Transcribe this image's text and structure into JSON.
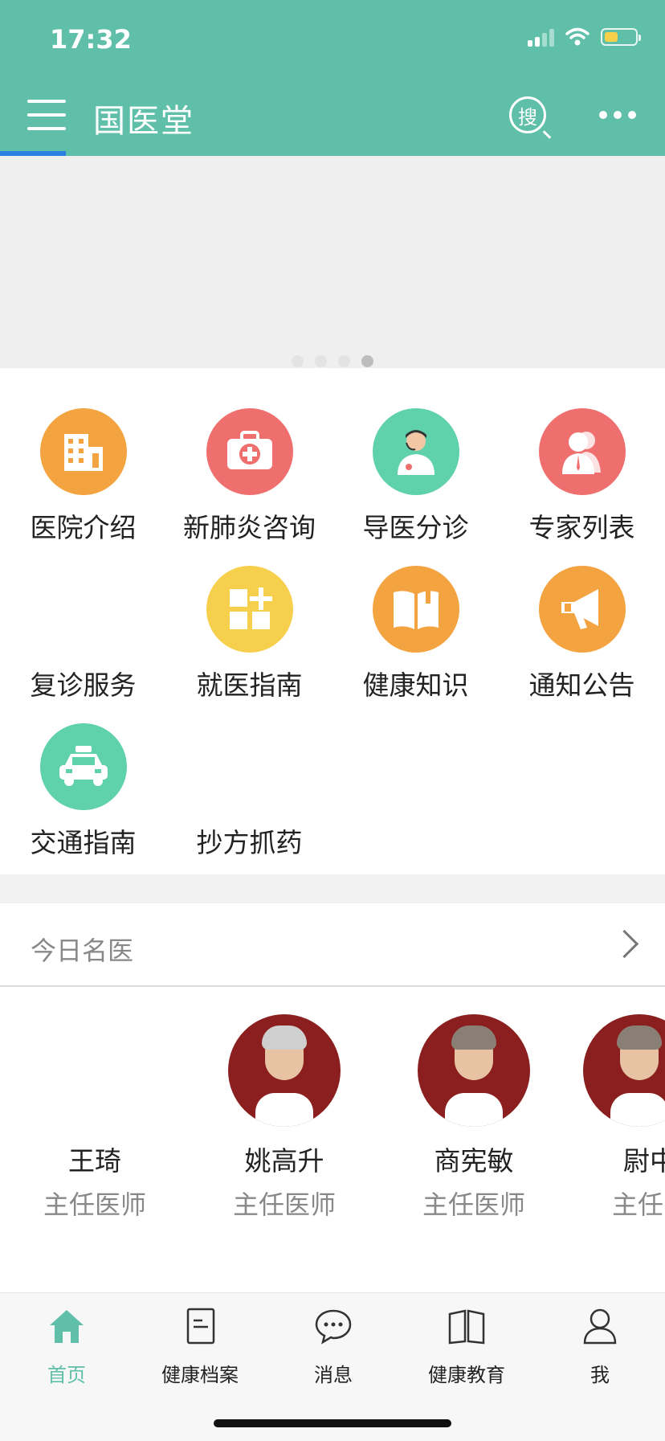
{
  "status": {
    "time": "17:32"
  },
  "header": {
    "title": "国医堂"
  },
  "colors": {
    "header": "#5fbfa9",
    "accent_tab": "#5fbfa9",
    "underline": "#2b7fe0"
  },
  "banner": {
    "dots_total": 4,
    "active_dot": 4
  },
  "grid": {
    "items": [
      {
        "label": "医院介绍",
        "icon": "building-icon",
        "color": "#f4a341"
      },
      {
        "label": "新肺炎咨询",
        "icon": "medical-kit-icon",
        "color": "#ef6f6f"
      },
      {
        "label": "导医分诊",
        "icon": "doctor-headset-icon",
        "color": "#5fd1ab"
      },
      {
        "label": "专家列表",
        "icon": "experts-icon",
        "color": "#ef6f6f"
      },
      {
        "label": "复诊服务",
        "icon": "",
        "color": ""
      },
      {
        "label": "就医指南",
        "icon": "grid-plus-icon",
        "color": "#f6cf4d"
      },
      {
        "label": "健康知识",
        "icon": "book-icon",
        "color": "#f4a341"
      },
      {
        "label": "通知公告",
        "icon": "megaphone-icon",
        "color": "#f4a341"
      },
      {
        "label": "交通指南",
        "icon": "taxi-icon",
        "color": "#5fd1ab"
      },
      {
        "label": "抄方抓药",
        "icon": "",
        "color": ""
      }
    ]
  },
  "doctors_section": {
    "title": "今日名医",
    "doctors": [
      {
        "name": "王琦",
        "title": "主任医师"
      },
      {
        "name": "姚高升",
        "title": "主任医师"
      },
      {
        "name": "商宪敏",
        "title": "主任医师"
      },
      {
        "name": "尉中",
        "title": "主任"
      }
    ]
  },
  "tabbar": {
    "items": [
      {
        "label": "首页",
        "icon": "home-icon"
      },
      {
        "label": "健康档案",
        "icon": "document-icon"
      },
      {
        "label": "消息",
        "icon": "chat-icon"
      },
      {
        "label": "健康教育",
        "icon": "open-book-icon"
      },
      {
        "label": "我",
        "icon": "person-icon"
      }
    ]
  }
}
